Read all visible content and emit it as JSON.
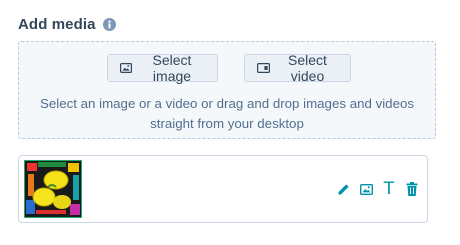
{
  "section": {
    "title": "Add media",
    "info_icon": "info-icon"
  },
  "dropzone": {
    "select_image_label": "Select image",
    "select_image_icon": "image-icon",
    "select_video_label": "Select video",
    "select_video_icon": "video-icon",
    "hint_line1": "Select an image or a video or drag and drop images and videos",
    "hint_line2": "straight from your desktop"
  },
  "media_item": {
    "thumbnail_icon": "lemons-image-thumbnail",
    "actions": [
      {
        "name": "edit",
        "icon": "pencil-icon"
      },
      {
        "name": "replace-image",
        "icon": "image-icon"
      },
      {
        "name": "text",
        "icon": "text-icon",
        "glyph": "T"
      },
      {
        "name": "delete",
        "icon": "trash-icon"
      }
    ]
  },
  "colors": {
    "title": "#33475b",
    "accent": "#0091ae",
    "hint_text": "#516f90",
    "dropzone_bg": "#f5f8fa",
    "button_bg": "#eaf0f6"
  }
}
